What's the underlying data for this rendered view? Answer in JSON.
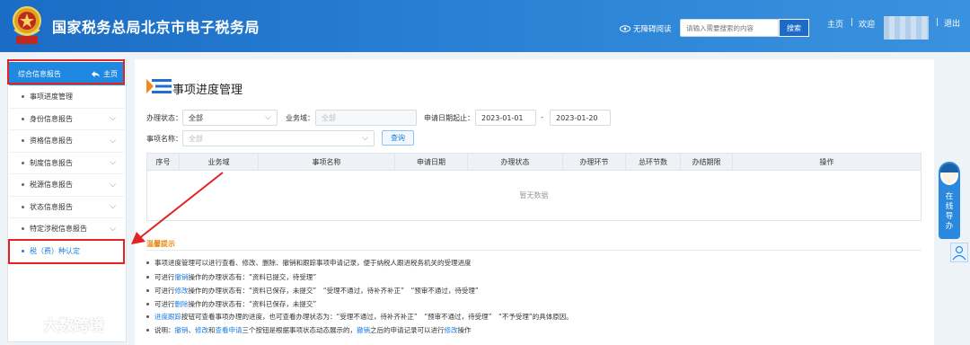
{
  "header": {
    "site_title": "国家税务总局北京市电子税务局",
    "accessibility_label": "无障碍阅读",
    "search_placeholder": "请输入需要搜索的内容",
    "search_button": "搜索",
    "home_link": "主页",
    "separator": "|",
    "welcome": "欢迎",
    "logout": "退出"
  },
  "sidebar": {
    "header_label": "综合信息报告",
    "header_home": "主页",
    "items": [
      {
        "label": "事项进度管理",
        "has_chevron": false
      },
      {
        "label": "身份信息报告",
        "has_chevron": true
      },
      {
        "label": "资格信息报告",
        "has_chevron": true
      },
      {
        "label": "制度信息报告",
        "has_chevron": true
      },
      {
        "label": "税源信息报告",
        "has_chevron": true
      },
      {
        "label": "状态信息报告",
        "has_chevron": true
      },
      {
        "label": "特定涉税信息报告",
        "has_chevron": true
      },
      {
        "label": "税（费）种认定",
        "has_chevron": false
      }
    ]
  },
  "main": {
    "page_title": "事项进度管理",
    "filters": {
      "status_label": "办理状态：",
      "status_value": "全部",
      "domain_label": "业务域：",
      "domain_value": "全部",
      "date_label": "申请日期起止：",
      "date_from": "2023-01-01",
      "date_dash": "-",
      "date_to": "2023-01-20",
      "item_name_label": "事项名称：",
      "item_name_value": "全部",
      "query_button": "查询"
    },
    "table": {
      "columns": [
        "序号",
        "业务域",
        "事项名称",
        "申请日期",
        "办理状态",
        "办理环节",
        "总环节数",
        "办结期限",
        "操作"
      ],
      "empty_text": "暂无数据"
    },
    "tips": {
      "title": "温馨提示",
      "lines": [
        [
          {
            "t": "事项进度管理可以进行查看、修改、删除、撤销和跟踪事项申请记录，便于纳税人跟进税务机关的受理进度"
          }
        ],
        [
          {
            "t": "可进行"
          },
          {
            "t": "撤销",
            "link": true
          },
          {
            "t": "操作的办理状态有：“资料已提交，待受理”"
          }
        ],
        [
          {
            "t": "可进行"
          },
          {
            "t": "修改",
            "link": true
          },
          {
            "t": "操作的办理状态有：“资料已保存，未提交”　“受理不通过，待补齐补正”　“预审不通过，待受理”"
          }
        ],
        [
          {
            "t": "可进行"
          },
          {
            "t": "删除",
            "link": true
          },
          {
            "t": "操作的办理状态有：“资料已保存，未提交”"
          }
        ],
        [
          {
            "t": "进度跟踪",
            "link": true
          },
          {
            "t": "按钮可查看事项办理的进度，也可查看办理状态为：“受理不通过，待补齐补正”　“预审不通过，待受理”　“不予受理”的具体原因。"
          }
        ],
        [
          {
            "t": "说明："
          },
          {
            "t": "撤销",
            "link": true
          },
          {
            "t": "、"
          },
          {
            "t": "修改",
            "link": true
          },
          {
            "t": "和"
          },
          {
            "t": "查看申请",
            "link": true
          },
          {
            "t": "三个按钮是根据事项状态动态展示的，"
          },
          {
            "t": "撤销",
            "link": true
          },
          {
            "t": "之后的申请记录可以进行"
          },
          {
            "t": "修改",
            "link": true
          },
          {
            "t": "操作"
          }
        ]
      ]
    }
  },
  "right_widget": {
    "online_guide_label": "在线导办"
  },
  "watermark": {
    "text": "大数跨境"
  },
  "colors": {
    "header_blue": "#1b6cc4",
    "active_blue": "#1f88e0",
    "link_blue": "#1a7ce0",
    "annotation_red": "#e02424",
    "tip_orange": "#e98a15"
  }
}
